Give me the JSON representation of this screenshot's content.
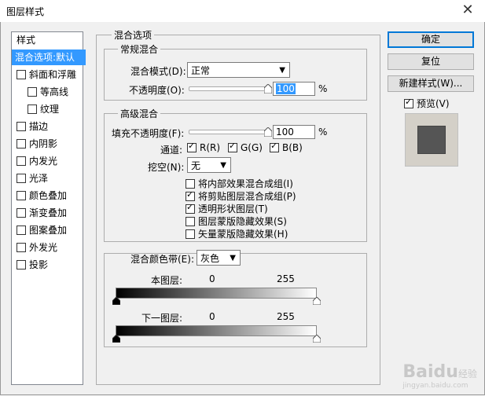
{
  "window": {
    "title": "图层样式",
    "close": "✕"
  },
  "styles": {
    "header": "样式",
    "items": [
      {
        "label": "混合选项:默认",
        "checkbox": false,
        "selected": true
      },
      {
        "label": "斜面和浮雕",
        "checkbox": true,
        "checked": false
      },
      {
        "label": "等高线",
        "checkbox": true,
        "checked": false,
        "indent": true
      },
      {
        "label": "纹理",
        "checkbox": true,
        "checked": false,
        "indent": true
      },
      {
        "label": "描边",
        "checkbox": true,
        "checked": false
      },
      {
        "label": "内阴影",
        "checkbox": true,
        "checked": false
      },
      {
        "label": "内发光",
        "checkbox": true,
        "checked": false
      },
      {
        "label": "光泽",
        "checkbox": true,
        "checked": false
      },
      {
        "label": "颜色叠加",
        "checkbox": true,
        "checked": false
      },
      {
        "label": "渐变叠加",
        "checkbox": true,
        "checked": false
      },
      {
        "label": "图案叠加",
        "checkbox": true,
        "checked": false
      },
      {
        "label": "外发光",
        "checkbox": true,
        "checked": false
      },
      {
        "label": "投影",
        "checkbox": true,
        "checked": false
      }
    ]
  },
  "blend": {
    "title": "混合选项",
    "general": {
      "title": "常规混合",
      "mode_label": "混合模式(D):",
      "mode_value": "正常",
      "opacity_label": "不透明度(O):",
      "opacity_value": "100",
      "unit": "%",
      "opacity_level": 1.0
    },
    "advanced": {
      "title": "高级混合",
      "fill_label": "填充不透明度(F):",
      "fill_value": "100",
      "unit": "%",
      "fill_level": 1.0,
      "channels_label": "通道:",
      "channels": [
        {
          "label": "R(R)",
          "checked": true
        },
        {
          "label": "G(G)",
          "checked": true
        },
        {
          "label": "B(B)",
          "checked": true
        }
      ],
      "knockout_label": "挖空(N):",
      "knockout_value": "无",
      "options": [
        {
          "label": "将内部效果混合成组(I)",
          "checked": false
        },
        {
          "label": "将剪贴图层混合成组(P)",
          "checked": true
        },
        {
          "label": "透明形状图层(T)",
          "checked": true
        },
        {
          "label": "图层蒙版隐藏效果(S)",
          "checked": false
        },
        {
          "label": "矢量蒙版隐藏效果(H)",
          "checked": false
        }
      ]
    },
    "blend_if": {
      "label": "混合颜色带(E):",
      "value": "灰色",
      "this_layer": {
        "label": "本图层:",
        "min": "0",
        "max": "255"
      },
      "under_layer": {
        "label": "下一图层:",
        "min": "0",
        "max": "255"
      }
    }
  },
  "buttons": {
    "ok": "确定",
    "reset": "复位",
    "new_style": "新建样式(W)...",
    "preview_label": "预览(V)",
    "preview_checked": true
  },
  "watermark": {
    "text": "Baidu",
    "sub": "经验",
    "url": "jingyan.baidu.com"
  }
}
